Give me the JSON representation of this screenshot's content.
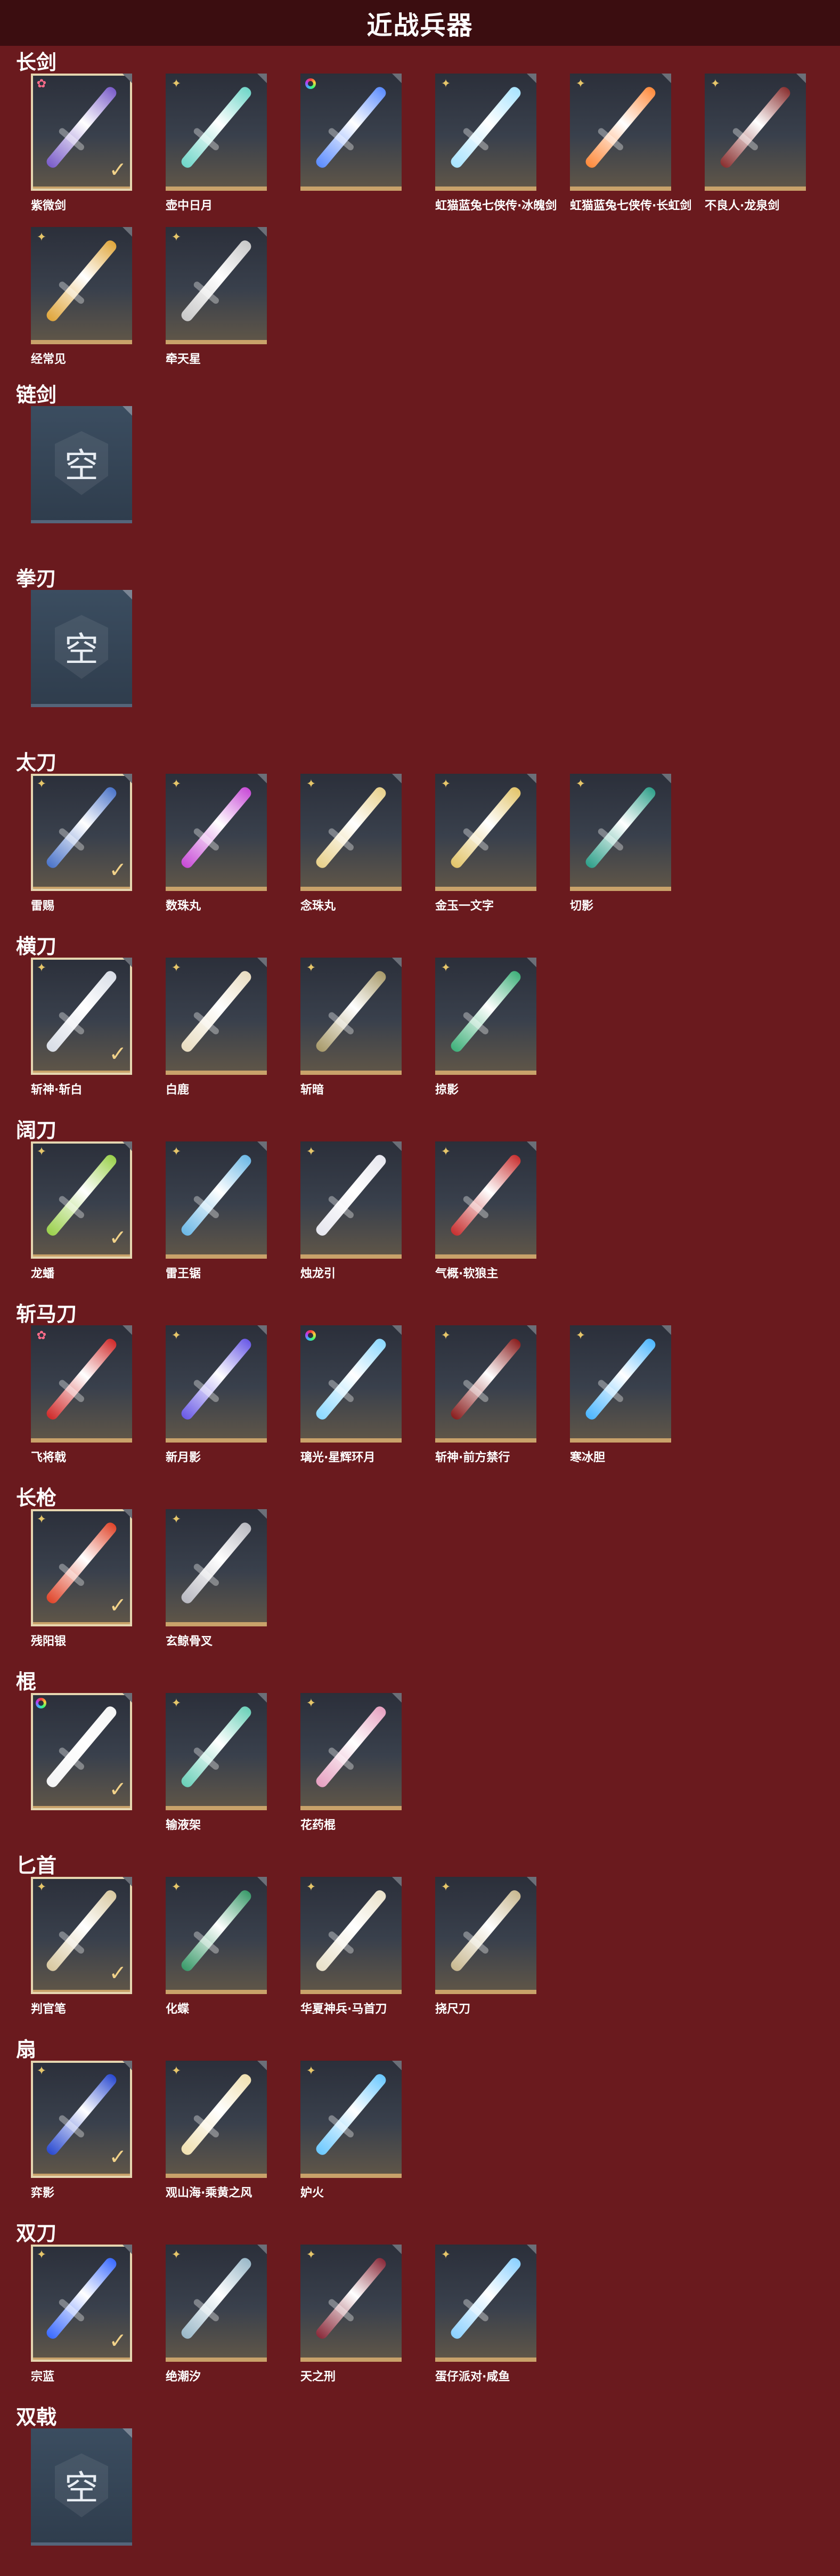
{
  "page": {
    "title": "近战兵器"
  },
  "colors": {
    "background": "#6a1a1e",
    "title_bar": "#3b0d10",
    "card_border": "#c9a26a",
    "check": "#f2d289"
  },
  "categories": [
    {
      "label": "长剑",
      "items": [
        {
          "name": "紫微剑",
          "badge": "pink-star",
          "selected": true,
          "tint": "#7a5cc9"
        },
        {
          "name": "壶中日月",
          "badge": "gold-star",
          "selected": false,
          "tint": "#6fd6c8"
        },
        {
          "name": "",
          "badge": "rainbow",
          "selected": false,
          "tint": "#5b8cff"
        },
        {
          "name": "虹猫蓝兔七侠传·冰魄剑",
          "badge": "gold-star",
          "selected": false,
          "tint": "#a8e4ff"
        },
        {
          "name": "虹猫蓝兔七侠传·长虹剑",
          "badge": "gold-star",
          "selected": false,
          "tint": "#ff8a3b"
        },
        {
          "name": "不良人·龙泉剑",
          "badge": "gold-star",
          "selected": false,
          "tint": "#8a3030"
        },
        {
          "name": "经常见",
          "badge": "gold-star",
          "selected": false,
          "tint": "#e0a63b"
        },
        {
          "name": "牵天星",
          "badge": "gold-star",
          "selected": false,
          "tint": "#c8c8c8"
        }
      ]
    },
    {
      "label": "链剑",
      "empty": "空"
    },
    {
      "label": "拳刃",
      "empty": "空"
    },
    {
      "label": "太刀",
      "items": [
        {
          "name": "雷赐",
          "badge": "gold-star",
          "selected": true,
          "tint": "#4b74c9"
        },
        {
          "name": "数珠丸",
          "badge": "gold-star",
          "selected": false,
          "tint": "#c84bd6"
        },
        {
          "name": "念珠丸",
          "badge": "gold-star",
          "selected": false,
          "tint": "#e8d08a"
        },
        {
          "name": "金玉一文字",
          "badge": "gold-star",
          "selected": false,
          "tint": "#e2c46a"
        },
        {
          "name": "切影",
          "badge": "gold-star",
          "selected": false,
          "tint": "#2fa08a"
        }
      ]
    },
    {
      "label": "横刀",
      "items": [
        {
          "name": "斩神·斩白",
          "badge": "gold-star",
          "selected": true,
          "tint": "#d8dde6"
        },
        {
          "name": "白鹿",
          "badge": "gold-star",
          "selected": false,
          "tint": "#e8dcc0"
        },
        {
          "name": "斩暗",
          "badge": "gold-star",
          "selected": false,
          "tint": "#a89a6a"
        },
        {
          "name": "掠影",
          "badge": "gold-star",
          "selected": false,
          "tint": "#3fb07a"
        }
      ]
    },
    {
      "label": "阔刀",
      "items": [
        {
          "name": "龙蟠",
          "badge": "gold-star",
          "selected": true,
          "tint": "#9ad04b"
        },
        {
          "name": "雷王锯",
          "badge": "gold-star",
          "selected": false,
          "tint": "#6bb8e6"
        },
        {
          "name": "烛龙引",
          "badge": "gold-star",
          "selected": false,
          "tint": "#e6e6ee"
        },
        {
          "name": "气概·软狼主",
          "badge": "gold-star",
          "selected": false,
          "tint": "#c83030"
        }
      ]
    },
    {
      "label": "斩马刀",
      "items": [
        {
          "name": "飞将戟",
          "badge": "pink-star",
          "selected": false,
          "tint": "#d02a2a"
        },
        {
          "name": "新月影",
          "badge": "gold-star",
          "selected": false,
          "tint": "#6a5ae6"
        },
        {
          "name": "璃光·星辉环月",
          "badge": "rainbow",
          "selected": false,
          "tint": "#8ad8ff"
        },
        {
          "name": "斩神·前方禁行",
          "badge": "gold-star",
          "selected": false,
          "tint": "#8a1e1e"
        },
        {
          "name": "寒冰胆",
          "badge": "gold-star",
          "selected": false,
          "tint": "#4bb6ff"
        }
      ]
    },
    {
      "label": "长枪",
      "items": [
        {
          "name": "残阳银",
          "badge": "gold-star",
          "selected": true,
          "tint": "#e0452a"
        },
        {
          "name": "玄鲸骨叉",
          "badge": "gold-star",
          "selected": false,
          "tint": "#b8b8c0"
        }
      ]
    },
    {
      "label": "棍",
      "items": [
        {
          "name": "",
          "badge": "rainbow",
          "selected": true,
          "tint": "#f4f4f4"
        },
        {
          "name": "输液架",
          "badge": "gold-star",
          "selected": false,
          "tint": "#6ad0b8"
        },
        {
          "name": "花药棍",
          "badge": "gold-star",
          "selected": false,
          "tint": "#e6a0c0"
        }
      ]
    },
    {
      "label": "匕首",
      "items": [
        {
          "name": "判官笔",
          "badge": "gold-star",
          "selected": true,
          "tint": "#d8c8a0"
        },
        {
          "name": "化蝶",
          "badge": "gold-star",
          "selected": false,
          "tint": "#3a9a6a"
        },
        {
          "name": "华夏神兵·马首刀",
          "badge": "gold-star",
          "selected": false,
          "tint": "#e8e0c8"
        },
        {
          "name": "挠尺刀",
          "badge": "gold-star",
          "selected": false,
          "tint": "#c8b890"
        }
      ]
    },
    {
      "label": "扇",
      "items": [
        {
          "name": "弈影",
          "badge": "gold-star",
          "selected": true,
          "tint": "#2a4ad0"
        },
        {
          "name": "观山海·乘黄之风",
          "badge": "gold-star",
          "selected": false,
          "tint": "#f0e0b0"
        },
        {
          "name": "妒火",
          "badge": "gold-star",
          "selected": false,
          "tint": "#6ac8ff"
        }
      ]
    },
    {
      "label": "双刀",
      "items": [
        {
          "name": "宗蓝",
          "badge": "gold-star",
          "selected": true,
          "tint": "#3a6aff"
        },
        {
          "name": "绝潮汐",
          "badge": "gold-star",
          "selected": false,
          "tint": "#9ab8c8"
        },
        {
          "name": "天之刑",
          "badge": "gold-star",
          "selected": false,
          "tint": "#8a2a3a"
        },
        {
          "name": "蛋仔派对·咸鱼",
          "badge": "gold-star",
          "selected": false,
          "tint": "#8ad0ff"
        }
      ]
    },
    {
      "label": "双戟",
      "empty": "空"
    }
  ]
}
